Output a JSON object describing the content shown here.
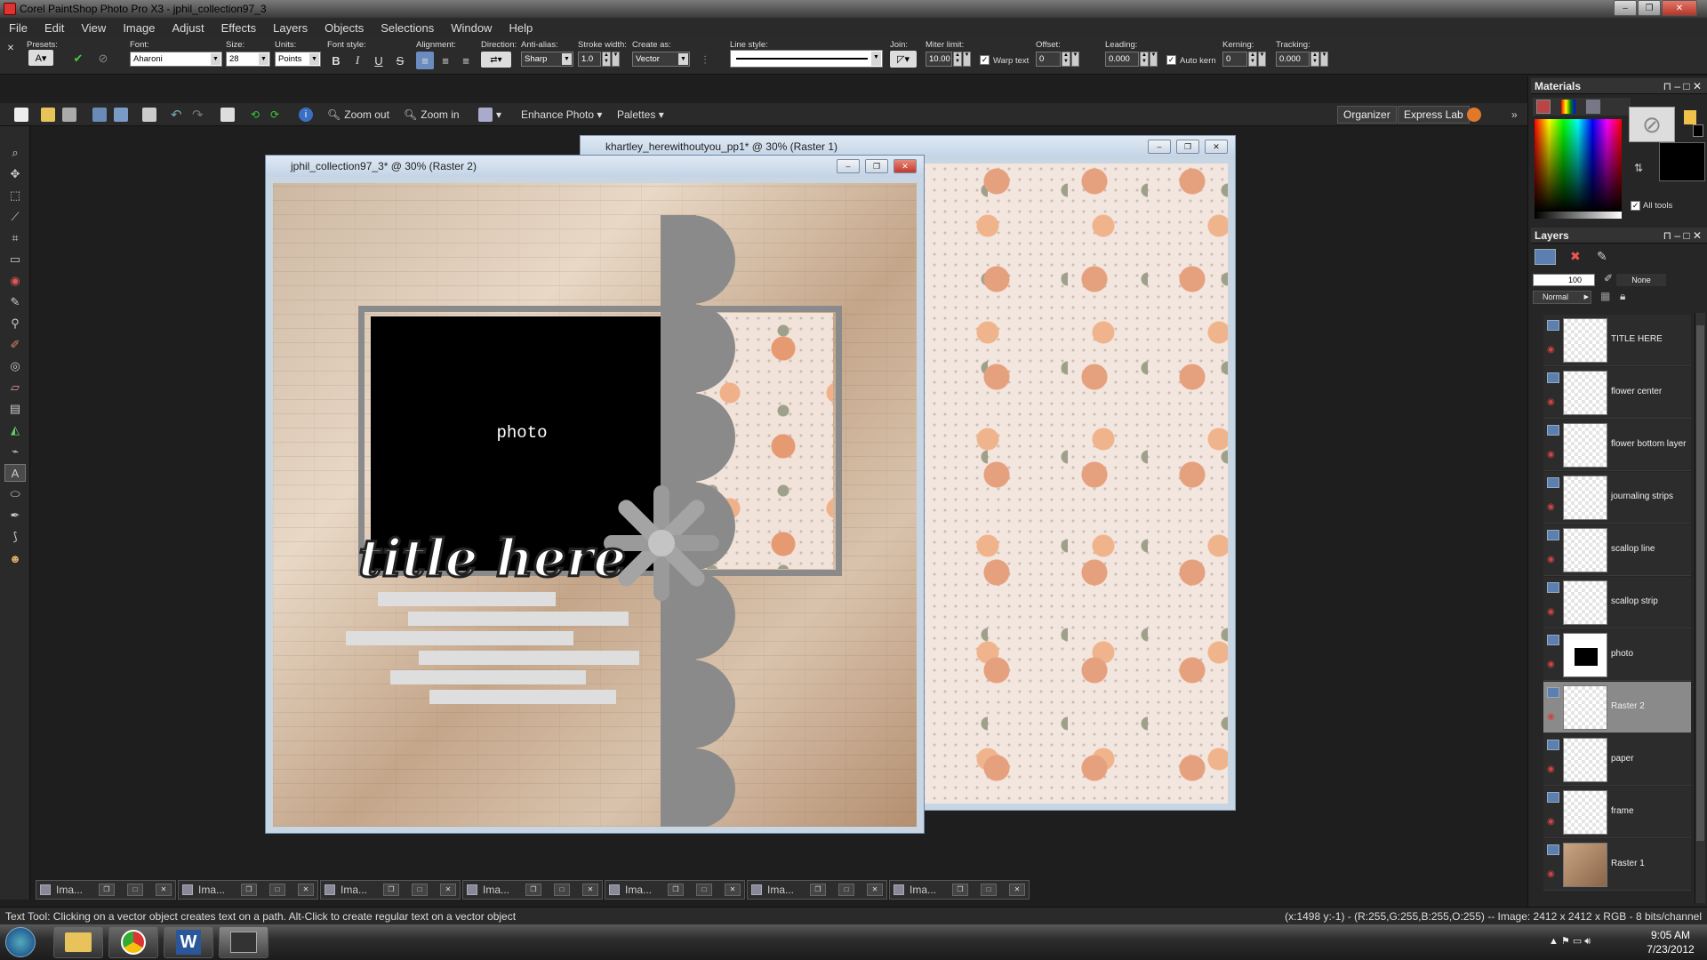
{
  "app": {
    "title": "Corel PaintShop Photo Pro X3 - jphil_collection97_3"
  },
  "menu": [
    "File",
    "Edit",
    "View",
    "Image",
    "Adjust",
    "Effects",
    "Layers",
    "Objects",
    "Selections",
    "Window",
    "Help"
  ],
  "options": {
    "presets_label": "Presets:",
    "font_label": "Font:",
    "font_value": "Aharoni",
    "size_label": "Size:",
    "size_value": "28",
    "units_label": "Units:",
    "units_value": "Points",
    "font_style_label": "Font style:",
    "style_buttons": [
      "B",
      "I",
      "U",
      "S"
    ],
    "alignment_label": "Alignment:",
    "direction_label": "Direction:",
    "antialias_label": "Anti-alias:",
    "antialias_value": "Sharp",
    "stroke_label": "Stroke width:",
    "stroke_value": "1.0",
    "createas_label": "Create as:",
    "createas_value": "Vector",
    "linestyle_label": "Line style:",
    "join_label": "Join:",
    "miter_label": "Miter limit:",
    "miter_value": "10.00",
    "warp_label": "Warp text",
    "offset_label": "Offset:",
    "offset_value": "0",
    "leading_label": "Leading:",
    "leading_value": "0.000",
    "autokern_label": "Auto kern",
    "kerning_label": "Kerning:",
    "kerning_value": "0",
    "tracking_label": "Tracking:",
    "tracking_value": "0.000"
  },
  "stdbar": {
    "zoom_out": "Zoom out",
    "zoom_in": "Zoom in",
    "enhance": "Enhance Photo",
    "palettes": "Palettes",
    "organizer": "Organizer",
    "express_lab": "Express Lab"
  },
  "doc_front": {
    "title": "jphil_collection97_3* @ 30% (Raster 2)",
    "photo_label": "photo",
    "title_text": "title here"
  },
  "doc_back": {
    "title": "khartley_herewithoutyou_pp1* @ 30% (Raster 1)"
  },
  "materials": {
    "header": "Materials",
    "all_tools": "All tools"
  },
  "layers": {
    "header": "Layers",
    "opacity": "100",
    "mask": "None",
    "blend": "Normal",
    "items": [
      {
        "name": "TITLE HERE"
      },
      {
        "name": "flower center"
      },
      {
        "name": "flower bottom layer"
      },
      {
        "name": "journaling strips"
      },
      {
        "name": "scallop line"
      },
      {
        "name": "scallop strip"
      },
      {
        "name": "photo"
      },
      {
        "name": "Raster 2"
      },
      {
        "name": "paper"
      },
      {
        "name": "frame"
      },
      {
        "name": "Raster 1"
      }
    ]
  },
  "minimized": [
    "Ima...",
    "Ima...",
    "Ima...",
    "Ima...",
    "Ima...",
    "Ima...",
    "Ima..."
  ],
  "status": {
    "left": "Text Tool: Clicking on a vector object creates text on a path. Alt-Click to create regular text on a vector object",
    "right": "(x:1498 y:-1) - (R:255,G:255,B:255,O:255) -- Image: 2412 x 2412 x RGB - 8 bits/channel"
  },
  "taskbar": {
    "time": "9:05 AM",
    "date": "7/23/2012"
  },
  "colors": {
    "accent_orange": "#e0945a",
    "selected_layer": "#8a8a8a"
  }
}
